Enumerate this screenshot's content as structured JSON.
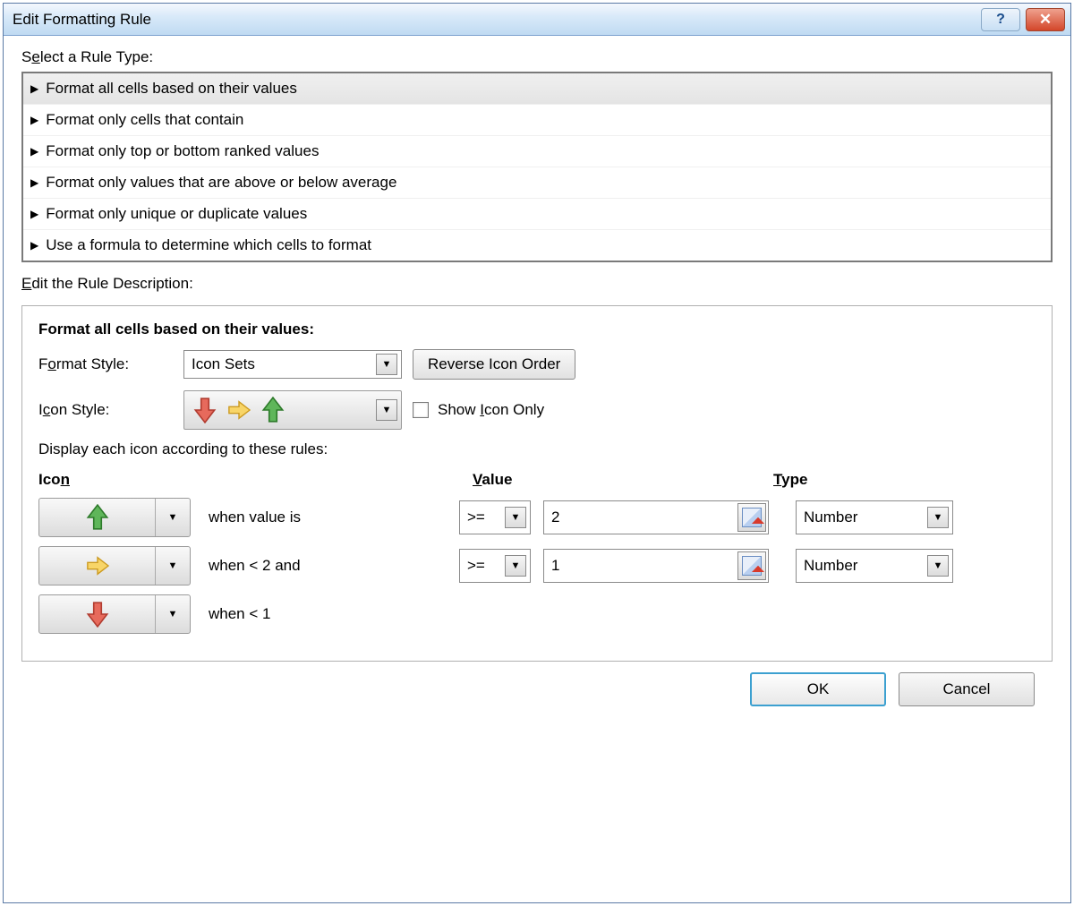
{
  "title": "Edit Formatting Rule",
  "section1": {
    "label_pre": "S",
    "label_u": "e",
    "label_post": "lect a Rule Type:"
  },
  "ruleTypes": [
    "Format all cells based on their values",
    "Format only cells that contain",
    "Format only top or bottom ranked values",
    "Format only values that are above or below average",
    "Format only unique or duplicate values",
    "Use a formula to determine which cells to format"
  ],
  "section2": {
    "label_u": "E",
    "label_post": "dit the Rule Description:"
  },
  "desc": {
    "title": "Format all cells based on their values:",
    "formatStyleLabel_pre": "F",
    "formatStyleLabel_u": "o",
    "formatStyleLabel_post": "rmat Style:",
    "formatStyleValue": "Icon Sets",
    "reverseBtn": "Reverse Icon Order",
    "iconStyleLabel_pre": "I",
    "iconStyleLabel_u": "c",
    "iconStyleLabel_post": "on Style:",
    "showIconOnly_pre": "Show ",
    "showIconOnly_u": "I",
    "showIconOnly_post": "con Only",
    "displayRulesLabel": "Display each icon according to these rules:"
  },
  "headers": {
    "icon_pre": "Ico",
    "icon_u": "n",
    "value_u": "V",
    "value_post": "alue",
    "type_u": "T",
    "type_post": "ype"
  },
  "rows": [
    {
      "when": "when value is",
      "op": ">=",
      "value": "2",
      "type": "Number"
    },
    {
      "when": "when < 2 and",
      "op": ">=",
      "value": "1",
      "type": "Number"
    },
    {
      "when": "when < 1"
    }
  ],
  "footer": {
    "ok": "OK",
    "cancel": "Cancel"
  }
}
